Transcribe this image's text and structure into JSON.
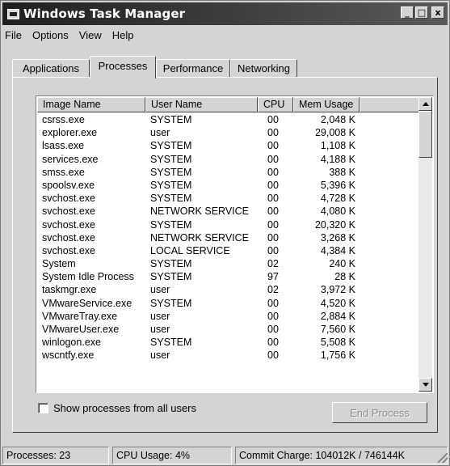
{
  "window": {
    "title": "Windows Task Manager"
  },
  "title_buttons": {
    "minimize": "_",
    "maximize": "□",
    "close": "x"
  },
  "menu": [
    "File",
    "Options",
    "View",
    "Help"
  ],
  "tabs": [
    "Applications",
    "Processes",
    "Performance",
    "Networking"
  ],
  "active_tab": "Processes",
  "columns": [
    "Image Name",
    "User Name",
    "CPU",
    "Mem Usage"
  ],
  "processes": [
    {
      "image": "csrss.exe",
      "user": "SYSTEM",
      "cpu": "00",
      "mem": "2,048 K"
    },
    {
      "image": "explorer.exe",
      "user": "user",
      "cpu": "00",
      "mem": "29,008 K"
    },
    {
      "image": "lsass.exe",
      "user": "SYSTEM",
      "cpu": "00",
      "mem": "1,108 K"
    },
    {
      "image": "services.exe",
      "user": "SYSTEM",
      "cpu": "00",
      "mem": "4,188 K"
    },
    {
      "image": "smss.exe",
      "user": "SYSTEM",
      "cpu": "00",
      "mem": "388 K"
    },
    {
      "image": "spoolsv.exe",
      "user": "SYSTEM",
      "cpu": "00",
      "mem": "5,396 K"
    },
    {
      "image": "svchost.exe",
      "user": "SYSTEM",
      "cpu": "00",
      "mem": "4,728 K"
    },
    {
      "image": "svchost.exe",
      "user": "NETWORK SERVICE",
      "cpu": "00",
      "mem": "4,080 K"
    },
    {
      "image": "svchost.exe",
      "user": "SYSTEM",
      "cpu": "00",
      "mem": "20,320 K"
    },
    {
      "image": "svchost.exe",
      "user": "NETWORK SERVICE",
      "cpu": "00",
      "mem": "3,268 K"
    },
    {
      "image": "svchost.exe",
      "user": "LOCAL SERVICE",
      "cpu": "00",
      "mem": "4,384 K"
    },
    {
      "image": "System",
      "user": "SYSTEM",
      "cpu": "02",
      "mem": "240 K"
    },
    {
      "image": "System Idle Process",
      "user": "SYSTEM",
      "cpu": "97",
      "mem": "28 K"
    },
    {
      "image": "taskmgr.exe",
      "user": "user",
      "cpu": "02",
      "mem": "3,972 K"
    },
    {
      "image": "VMwareService.exe",
      "user": "SYSTEM",
      "cpu": "00",
      "mem": "4,520 K"
    },
    {
      "image": "VMwareTray.exe",
      "user": "user",
      "cpu": "00",
      "mem": "2,884 K"
    },
    {
      "image": "VMwareUser.exe",
      "user": "user",
      "cpu": "00",
      "mem": "7,560 K"
    },
    {
      "image": "winlogon.exe",
      "user": "SYSTEM",
      "cpu": "00",
      "mem": "5,508 K"
    },
    {
      "image": "wscntfy.exe",
      "user": "user",
      "cpu": "00",
      "mem": "1,756 K"
    }
  ],
  "show_all_users": {
    "label": "Show processes from all users",
    "checked": false
  },
  "end_process": {
    "label": "End Process",
    "enabled": false
  },
  "status": {
    "processes": "Processes: 23",
    "cpu_usage": "CPU Usage: 4%",
    "commit_charge": "Commit Charge: 104012K / 746144K"
  }
}
